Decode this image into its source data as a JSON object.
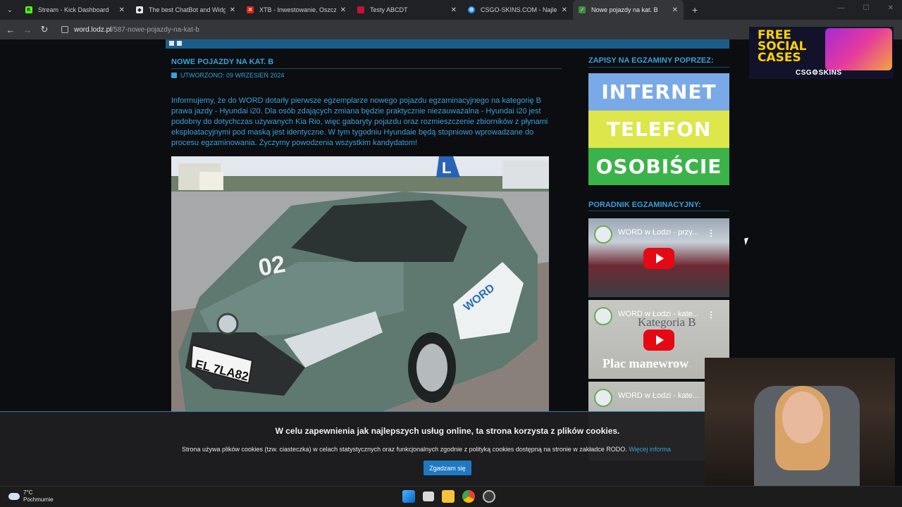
{
  "browser": {
    "tabs": [
      {
        "title": "Stream - Kick Dashboard",
        "favicon_color": "#53fc18",
        "active": false
      },
      {
        "title": "The best ChatBot and Widgets",
        "favicon_color": "#e8eaed",
        "active": false
      },
      {
        "title": "XTB - Inwestowanie, Oszczędn",
        "favicon_color": "#e1251b",
        "active": false
      },
      {
        "title": "Testy ABCDT",
        "favicon_color": "#c0143c",
        "active": false
      },
      {
        "title": "CSGO-SKINS.COM - Najlepsze",
        "favicon_color": "#1e90ff",
        "active": false
      },
      {
        "title": "Nowe pojazdy na kat. B",
        "favicon_color": "#3f8f3f",
        "active": true
      }
    ],
    "url_host": "word.lodz.pl",
    "url_path": "/587-nowe-pojazdy-na-kat-b"
  },
  "article": {
    "title": "NOWE POJAZDY NA KAT. B",
    "created": "UTWORZONO: 09 WRZESIEŃ 2024",
    "body": "Informujemy, że do WORD dotarły pierwsze egzemplarze nowego pojazdu egzaminacyjnego na kategorię B prawa jazdy - Hyundai i20. Dla osób zdających zmiana będzie praktycznie niezauważalna - Hyundai i20 jest podobny do dotychczas używanych Kia Rio, więc gabaryty pojazdu oraz rozmieszczenie zbiorników z płynami eksploatacyjnymi pod maską jest identyczne. W tym tygodniu Hyundaie będą stopniowo wprowadzane do procesu egzaminowania. Życzymy powodzenia wszystkim kandydatom!",
    "photo": {
      "plate": "EL 7LA82",
      "hood_number": "02",
      "door_text": "WORD",
      "roof_sign": "L"
    }
  },
  "sidebar": {
    "signup_heading": "ZAPISY NA EGZAMINY POPRZEZ:",
    "signup_options": [
      {
        "label": "INTERNET",
        "color": "#79a9e6"
      },
      {
        "label": "TELEFON",
        "color": "#dde64a"
      },
      {
        "label": "OSOBIŚCIE",
        "color": "#3cb34a"
      }
    ],
    "guide_heading": "PORADNIK EGZAMINACYJNY:",
    "videos": [
      {
        "title": "WORD w Łodzi - przy...",
        "overlay": ""
      },
      {
        "title": "WORD w Łodzi - kate...",
        "overlay": "Kategoria B"
      },
      {
        "title": "WORD w Łodzi - kate...",
        "overlay": ""
      }
    ],
    "video2_sub": "Plac manewrow"
  },
  "cookie": {
    "heading": "W celu zapewnienia jak najlepszych usług online, ta strona korzysta z plików cookies.",
    "text": "Strona używa plików cookies (tzw. ciasteczka) w celach statystycznych oraz funkcjonalnych zgodnie z polityką cookies dostępną na stronie w zakładce RODO.",
    "link": "Więcej informa",
    "button": "Zgadzam się"
  },
  "ad": {
    "line1": "FREE",
    "line2": "SOCIAL",
    "line3": "CASES",
    "brand": "CSG⚙SKINS"
  },
  "taskbar": {
    "temperature": "7°C",
    "condition": "Pochmurnie"
  }
}
